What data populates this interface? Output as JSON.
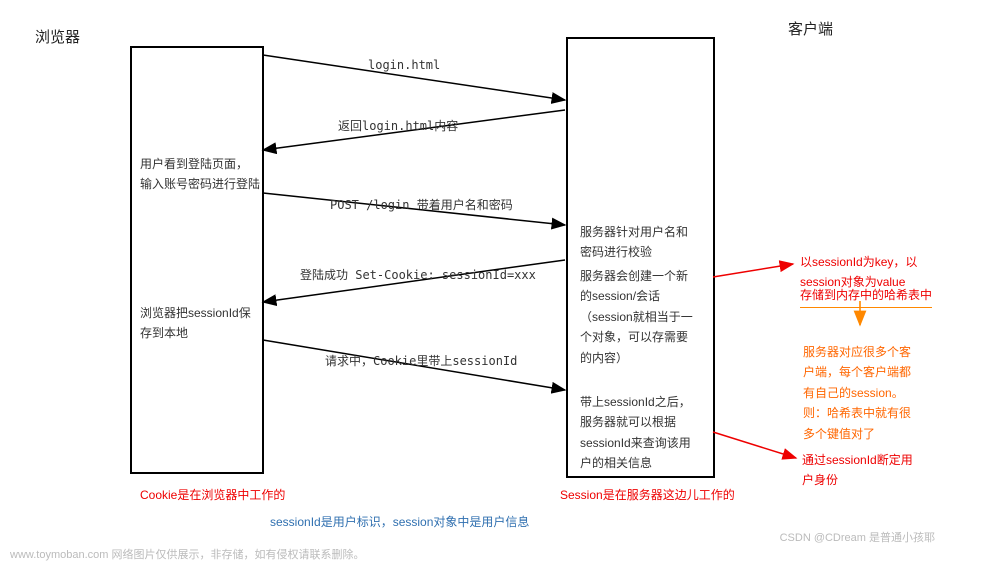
{
  "titles": {
    "browser": "浏览器",
    "client": "客户端"
  },
  "browser_box": {
    "text1": "用户看到登陆页面，\n输入账号密码进行登陆",
    "text2": "浏览器把sessionId保\n存到本地"
  },
  "server_box": {
    "text1": "服务器针对用户名和\n密码进行校验",
    "text2": "服务器会创建一个新\n的session/会话\n（session就相当于一\n个对象，可以存需要\n的内容）",
    "text3": "带上sessionId之后，\n服务器就可以根据\nsessionId来查询该用\n户的相关信息"
  },
  "arrows": {
    "req1": "login.html",
    "resp1": "返回login.html内容",
    "req2": "POST /login 带着用户名和密码",
    "resp2": "登陆成功 Set-Cookie: sessionId=xxx",
    "req3": "请求中，Cookie里带上sessionId"
  },
  "annotations": {
    "cookie_note": "Cookie是在浏览器中工作的",
    "session_note": "Session是在服务器这边儿工作的",
    "sessionid_note": "sessionId是用户标识，session对象中是用户信息",
    "hash_note1": "以sessionId为key，以\nsession对象为value",
    "hash_note2": "存储到内存中的哈希表中",
    "multi_client": "服务器对应很多个客\n户端，每个客户端都\n有自己的session。\n则：哈希表中就有很\n多个键值对了",
    "verify": "通过sessionId断定用\n户身份"
  },
  "footer": {
    "watermark_left": "www.toymoban.com 网络图片仅供展示，非存储，如有侵权请联系删除。",
    "watermark_right": "CSDN @CDream 是普通小孩耶"
  }
}
